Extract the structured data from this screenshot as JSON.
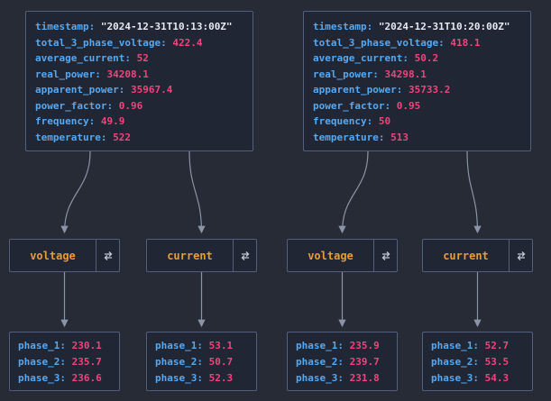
{
  "colors": {
    "canvas_bg": "#272b36",
    "node_bg": "#212634",
    "node_border": "#535f7d",
    "key_text": "#55a8f2",
    "number_text": "#f0447c",
    "string_text": "#e6e9ef",
    "group_text": "#e99b35",
    "edge": "#8b94a7"
  },
  "icons": {
    "group_toggle": "swap-horizontal-arrows-icon"
  },
  "records": [
    {
      "rows": [
        {
          "key": "timestamp:",
          "value": "\"2024-12-31T10:13:00Z\""
        },
        {
          "key": "total_3_phase_voltage:",
          "value": "422.4"
        },
        {
          "key": "average_current:",
          "value": "52"
        },
        {
          "key": "real_power:",
          "value": "34208.1"
        },
        {
          "key": "apparent_power:",
          "value": "35967.4"
        },
        {
          "key": "power_factor:",
          "value": "0.96"
        },
        {
          "key": "frequency:",
          "value": "49.9"
        },
        {
          "key": "temperature:",
          "value": "522"
        }
      ]
    },
    {
      "rows": [
        {
          "key": "timestamp:",
          "value": "\"2024-12-31T10:20:00Z\""
        },
        {
          "key": "total_3_phase_voltage:",
          "value": "418.1"
        },
        {
          "key": "average_current:",
          "value": "50.2"
        },
        {
          "key": "real_power:",
          "value": "34298.1"
        },
        {
          "key": "apparent_power:",
          "value": "35733.2"
        },
        {
          "key": "power_factor:",
          "value": "0.95"
        },
        {
          "key": "frequency:",
          "value": "50"
        },
        {
          "key": "temperature:",
          "value": "513"
        }
      ]
    }
  ],
  "groups": [
    {
      "label": "voltage"
    },
    {
      "label": "current"
    },
    {
      "label": "voltage"
    },
    {
      "label": "current"
    }
  ],
  "phases": [
    {
      "rows": [
        {
          "key": "phase_1:",
          "value": "230.1"
        },
        {
          "key": "phase_2:",
          "value": "235.7"
        },
        {
          "key": "phase_3:",
          "value": "236.6"
        }
      ]
    },
    {
      "rows": [
        {
          "key": "phase_1:",
          "value": "53.1"
        },
        {
          "key": "phase_2:",
          "value": "50.7"
        },
        {
          "key": "phase_3:",
          "value": "52.3"
        }
      ]
    },
    {
      "rows": [
        {
          "key": "phase_1:",
          "value": "235.9"
        },
        {
          "key": "phase_2:",
          "value": "239.7"
        },
        {
          "key": "phase_3:",
          "value": "231.8"
        }
      ]
    },
    {
      "rows": [
        {
          "key": "phase_1:",
          "value": "52.7"
        },
        {
          "key": "phase_2:",
          "value": "53.5"
        },
        {
          "key": "phase_3:",
          "value": "54.3"
        }
      ]
    }
  ]
}
